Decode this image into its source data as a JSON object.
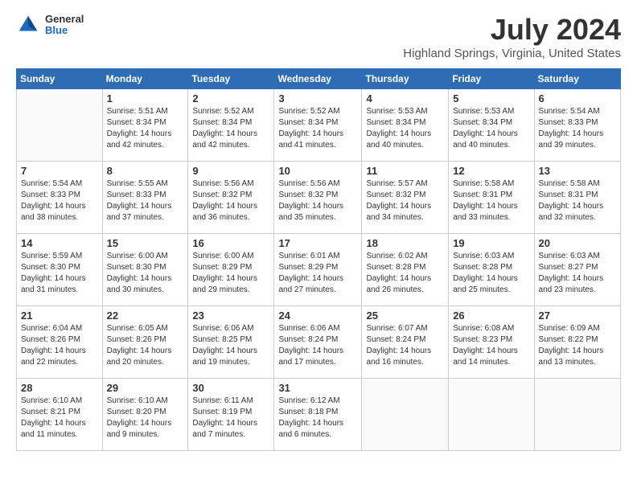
{
  "logo": {
    "general": "General",
    "blue": "Blue"
  },
  "title": "July 2024",
  "subtitle": "Highland Springs, Virginia, United States",
  "weekdays": [
    "Sunday",
    "Monday",
    "Tuesday",
    "Wednesday",
    "Thursday",
    "Friday",
    "Saturday"
  ],
  "weeks": [
    [
      null,
      {
        "day": "1",
        "sunrise": "5:51 AM",
        "sunset": "8:34 PM",
        "daylight": "14 hours and 42 minutes."
      },
      {
        "day": "2",
        "sunrise": "5:52 AM",
        "sunset": "8:34 PM",
        "daylight": "14 hours and 42 minutes."
      },
      {
        "day": "3",
        "sunrise": "5:52 AM",
        "sunset": "8:34 PM",
        "daylight": "14 hours and 41 minutes."
      },
      {
        "day": "4",
        "sunrise": "5:53 AM",
        "sunset": "8:34 PM",
        "daylight": "14 hours and 40 minutes."
      },
      {
        "day": "5",
        "sunrise": "5:53 AM",
        "sunset": "8:34 PM",
        "daylight": "14 hours and 40 minutes."
      },
      {
        "day": "6",
        "sunrise": "5:54 AM",
        "sunset": "8:33 PM",
        "daylight": "14 hours and 39 minutes."
      }
    ],
    [
      {
        "day": "7",
        "sunrise": "5:54 AM",
        "sunset": "8:33 PM",
        "daylight": "14 hours and 38 minutes."
      },
      {
        "day": "8",
        "sunrise": "5:55 AM",
        "sunset": "8:33 PM",
        "daylight": "14 hours and 37 minutes."
      },
      {
        "day": "9",
        "sunrise": "5:56 AM",
        "sunset": "8:32 PM",
        "daylight": "14 hours and 36 minutes."
      },
      {
        "day": "10",
        "sunrise": "5:56 AM",
        "sunset": "8:32 PM",
        "daylight": "14 hours and 35 minutes."
      },
      {
        "day": "11",
        "sunrise": "5:57 AM",
        "sunset": "8:32 PM",
        "daylight": "14 hours and 34 minutes."
      },
      {
        "day": "12",
        "sunrise": "5:58 AM",
        "sunset": "8:31 PM",
        "daylight": "14 hours and 33 minutes."
      },
      {
        "day": "13",
        "sunrise": "5:58 AM",
        "sunset": "8:31 PM",
        "daylight": "14 hours and 32 minutes."
      }
    ],
    [
      {
        "day": "14",
        "sunrise": "5:59 AM",
        "sunset": "8:30 PM",
        "daylight": "14 hours and 31 minutes."
      },
      {
        "day": "15",
        "sunrise": "6:00 AM",
        "sunset": "8:30 PM",
        "daylight": "14 hours and 30 minutes."
      },
      {
        "day": "16",
        "sunrise": "6:00 AM",
        "sunset": "8:29 PM",
        "daylight": "14 hours and 29 minutes."
      },
      {
        "day": "17",
        "sunrise": "6:01 AM",
        "sunset": "8:29 PM",
        "daylight": "14 hours and 27 minutes."
      },
      {
        "day": "18",
        "sunrise": "6:02 AM",
        "sunset": "8:28 PM",
        "daylight": "14 hours and 26 minutes."
      },
      {
        "day": "19",
        "sunrise": "6:03 AM",
        "sunset": "8:28 PM",
        "daylight": "14 hours and 25 minutes."
      },
      {
        "day": "20",
        "sunrise": "6:03 AM",
        "sunset": "8:27 PM",
        "daylight": "14 hours and 23 minutes."
      }
    ],
    [
      {
        "day": "21",
        "sunrise": "6:04 AM",
        "sunset": "8:26 PM",
        "daylight": "14 hours and 22 minutes."
      },
      {
        "day": "22",
        "sunrise": "6:05 AM",
        "sunset": "8:26 PM",
        "daylight": "14 hours and 20 minutes."
      },
      {
        "day": "23",
        "sunrise": "6:06 AM",
        "sunset": "8:25 PM",
        "daylight": "14 hours and 19 minutes."
      },
      {
        "day": "24",
        "sunrise": "6:06 AM",
        "sunset": "8:24 PM",
        "daylight": "14 hours and 17 minutes."
      },
      {
        "day": "25",
        "sunrise": "6:07 AM",
        "sunset": "8:24 PM",
        "daylight": "14 hours and 16 minutes."
      },
      {
        "day": "26",
        "sunrise": "6:08 AM",
        "sunset": "8:23 PM",
        "daylight": "14 hours and 14 minutes."
      },
      {
        "day": "27",
        "sunrise": "6:09 AM",
        "sunset": "8:22 PM",
        "daylight": "14 hours and 13 minutes."
      }
    ],
    [
      {
        "day": "28",
        "sunrise": "6:10 AM",
        "sunset": "8:21 PM",
        "daylight": "14 hours and 11 minutes."
      },
      {
        "day": "29",
        "sunrise": "6:10 AM",
        "sunset": "8:20 PM",
        "daylight": "14 hours and 9 minutes."
      },
      {
        "day": "30",
        "sunrise": "6:11 AM",
        "sunset": "8:19 PM",
        "daylight": "14 hours and 7 minutes."
      },
      {
        "day": "31",
        "sunrise": "6:12 AM",
        "sunset": "8:18 PM",
        "daylight": "14 hours and 6 minutes."
      },
      null,
      null,
      null
    ]
  ]
}
